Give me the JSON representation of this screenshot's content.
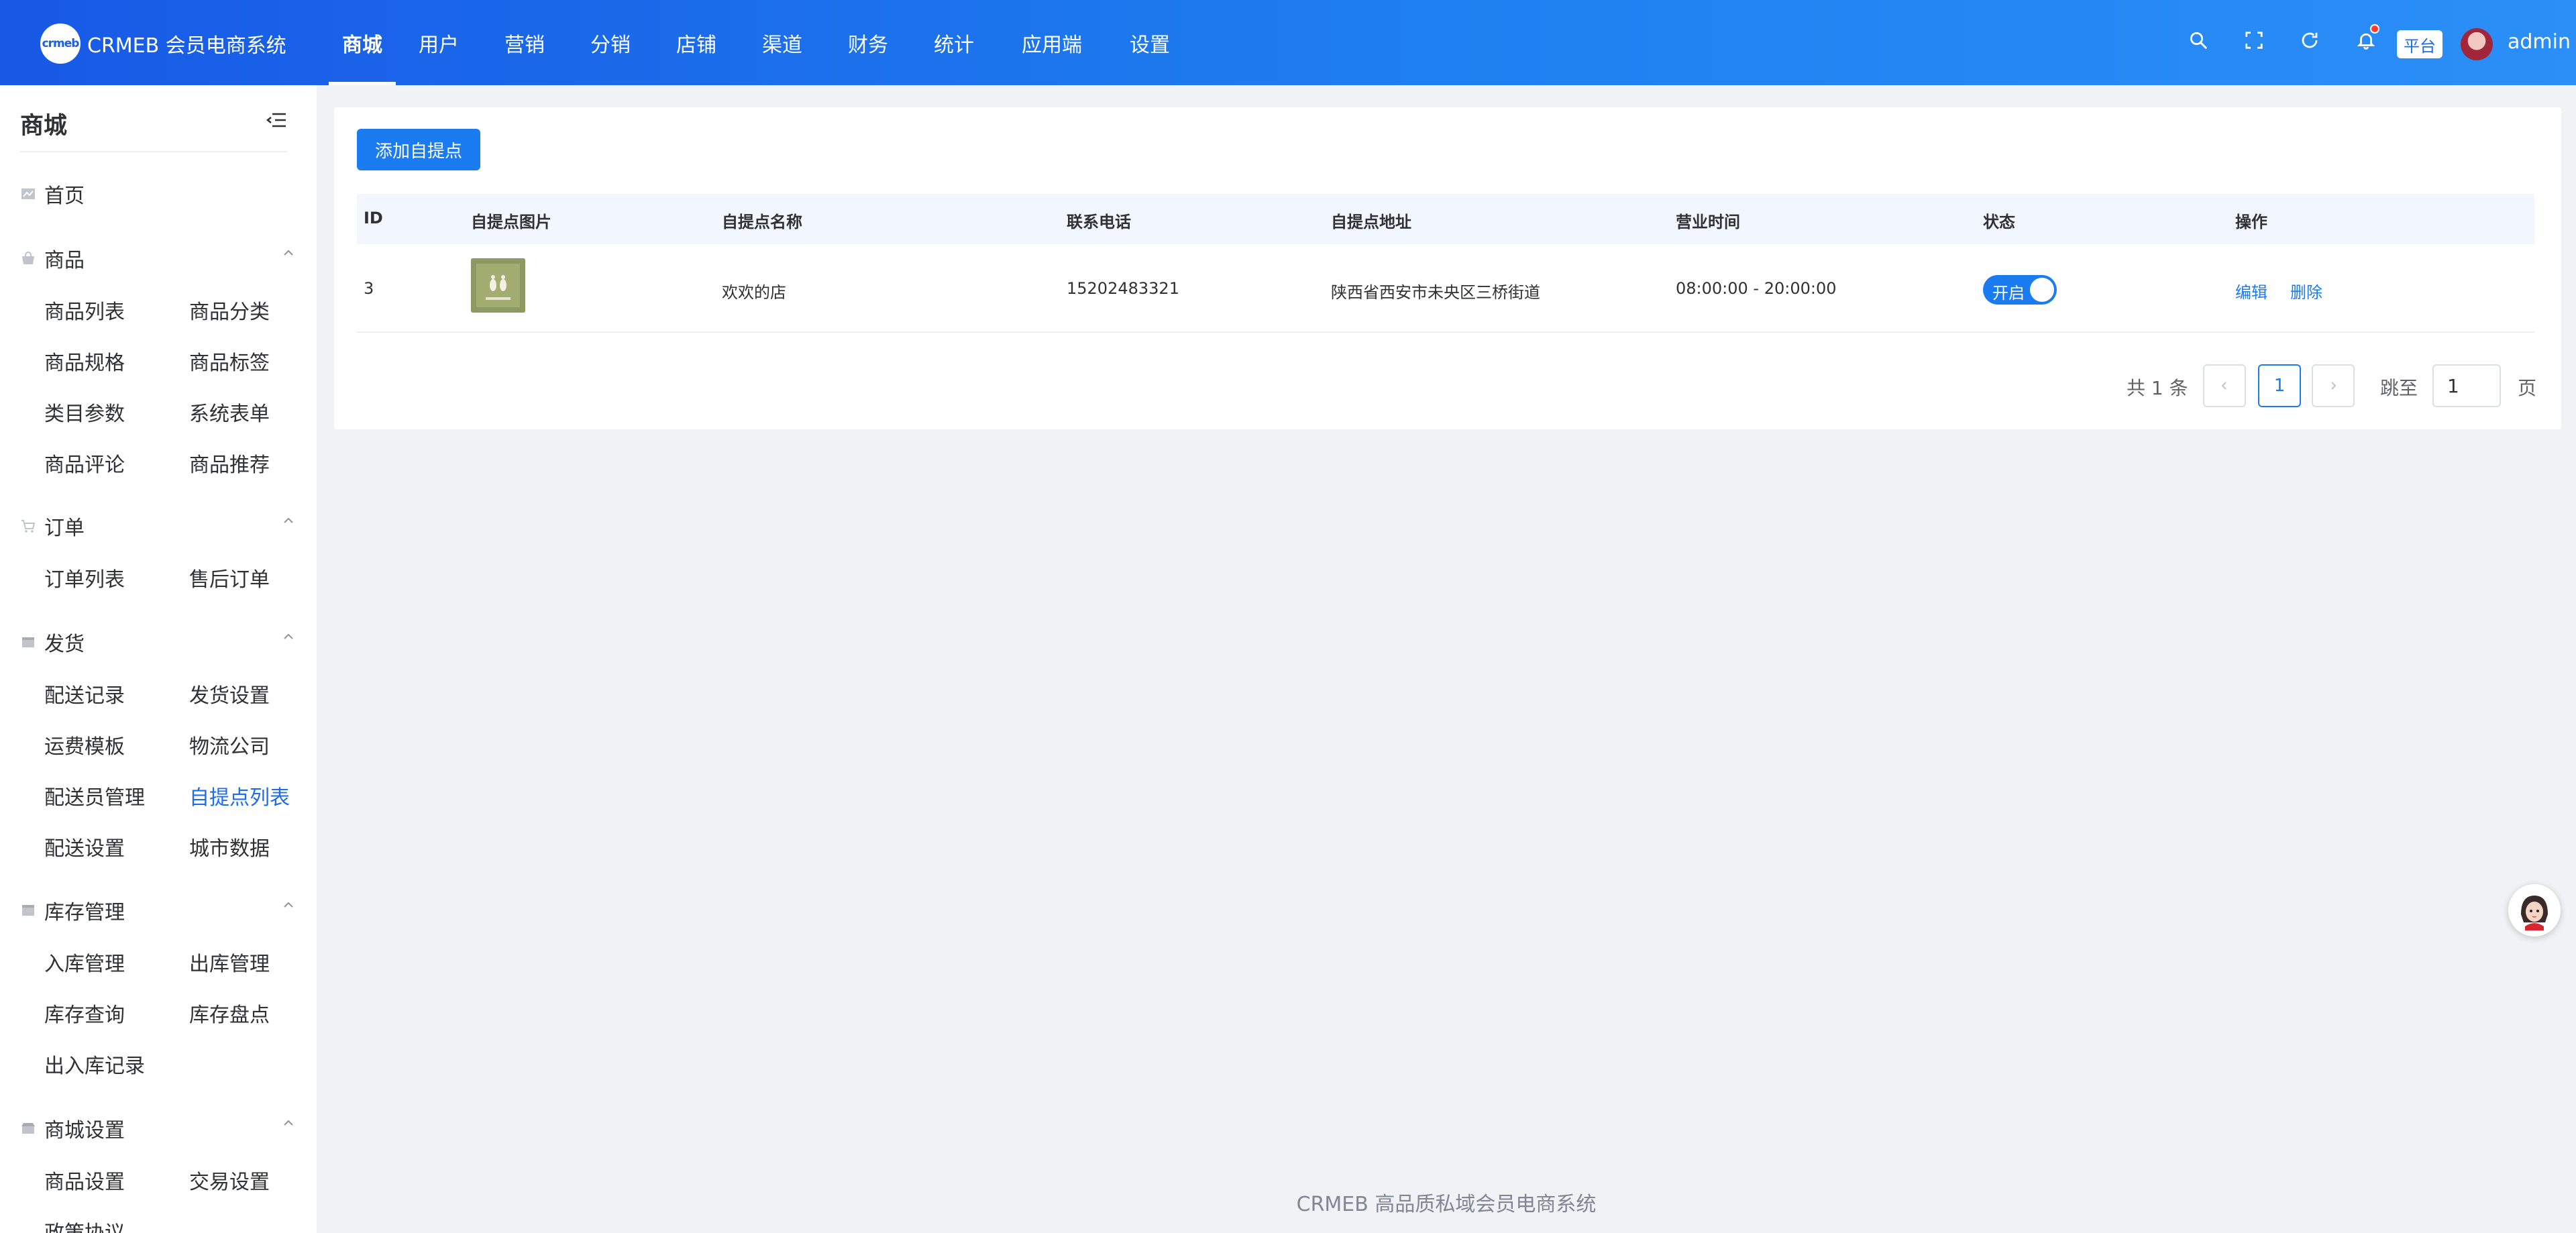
{
  "app": {
    "logo_mark": "crmeb",
    "logo_text": "CRMEB 会员电商系统"
  },
  "topnav": [
    {
      "label": "商城",
      "active": true
    },
    {
      "label": "用户"
    },
    {
      "label": "营销"
    },
    {
      "label": "分销"
    },
    {
      "label": "店铺"
    },
    {
      "label": "渠道"
    },
    {
      "label": "财务"
    },
    {
      "label": "统计"
    },
    {
      "label": "应用端"
    },
    {
      "label": "设置"
    }
  ],
  "header_right": {
    "platform_tag": "平台",
    "user_name": "admin",
    "icons": [
      "search-icon",
      "fullscreen-icon",
      "refresh-icon",
      "bell-icon"
    ]
  },
  "sidebar": {
    "title": "商城",
    "home": "首页",
    "groups": [
      {
        "label": "商品",
        "items": [
          "商品列表",
          "商品分类",
          "商品规格",
          "商品标签",
          "类目参数",
          "系统表单",
          "商品评论",
          "商品推荐"
        ]
      },
      {
        "label": "订单",
        "items": [
          "订单列表",
          "售后订单"
        ]
      },
      {
        "label": "发货",
        "items": [
          "配送记录",
          "发货设置",
          "运费模板",
          "物流公司",
          "配送员管理",
          "自提点列表",
          "配送设置",
          "城市数据"
        ]
      },
      {
        "label": "库存管理",
        "items": [
          "入库管理",
          "出库管理",
          "库存查询",
          "库存盘点",
          "出入库记录"
        ]
      },
      {
        "label": "商城设置",
        "items": [
          "商品设置",
          "交易设置",
          "政策协议"
        ]
      }
    ],
    "active_item": "自提点列表"
  },
  "toolbar": {
    "add_button": "添加自提点"
  },
  "table": {
    "columns": [
      "ID",
      "自提点图片",
      "自提点名称",
      "联系电话",
      "自提点地址",
      "营业时间",
      "状态",
      "操作"
    ],
    "rows": [
      {
        "id": "3",
        "name": "欢欢的店",
        "phone": "15202483321",
        "address": "陕西省西安市未央区三桥街道",
        "hours": "08:00:00 - 20:00:00",
        "status_label": "开启",
        "status_on": true,
        "actions": [
          "编辑",
          "删除"
        ]
      }
    ]
  },
  "pagination": {
    "total_text": "共 1 条",
    "prev": "<",
    "current": "1",
    "next": ">",
    "jump_label": "跳至",
    "jump_value": "1",
    "page_unit": "页"
  },
  "footer": {
    "text": "CRMEB 高品质私域会员电商系统"
  },
  "colors": {
    "accent": "#1a7cf0",
    "header_start": "#1859e6",
    "header_end": "#2b8ff7"
  }
}
